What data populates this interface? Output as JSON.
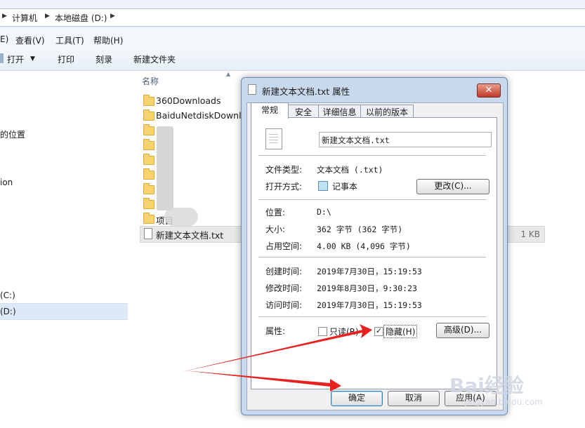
{
  "address": {
    "crumbs": [
      "计算机",
      "本地磁盘 (D:)"
    ]
  },
  "menu": {
    "view": "查看(V)",
    "tools": "工具(T)",
    "help": "帮助(H)"
  },
  "toolbar": {
    "open": "打开",
    "print": "打印",
    "burn": "刻录",
    "new_folder": "新建文件夹"
  },
  "nav": {
    "recent": "的位置",
    "cut_item": "ion",
    "drive_c": "(C:)",
    "drive_d": "(D:)"
  },
  "filelist": {
    "header_name": "名称",
    "files": [
      {
        "name": "360Downloads"
      },
      {
        "name": "BaiduNetdiskDownlo"
      },
      {
        "name": "新建文本文档.txt"
      }
    ],
    "item_tail": "项目",
    "selected_size": "1 KB"
  },
  "dialog": {
    "title": "新建文本文档.txt 属性",
    "close": "✕",
    "tabs": [
      "常规",
      "安全",
      "详细信息",
      "以前的版本"
    ],
    "file_name": "新建文本文档.txt",
    "type_label": "文件类型:",
    "type_value": "文本文档 (.txt)",
    "opens_label": "打开方式:",
    "opens_value": "记事本",
    "change_btn": "更改(C)...",
    "location_label": "位置:",
    "location_value": "D:\\",
    "size_label": "大小:",
    "size_value": "362 字节 (362 字节)",
    "disk_label": "占用空间:",
    "disk_value": "4.00 KB (4,096 字节)",
    "created_label": "创建时间:",
    "created_value": "2019年7月30日，15:19:53",
    "modified_label": "修改时间:",
    "modified_value": "2019年8月30日，9:30:23",
    "accessed_label": "访问时间:",
    "accessed_value": "2019年7月30日，15:19:53",
    "attr_label": "属性:",
    "readonly_label": "只读(R)",
    "hidden_label": "隐藏(H)",
    "advanced_btn": "高级(D)...",
    "ok_btn": "确定",
    "cancel_btn": "取消",
    "apply_btn": "应用(A)"
  },
  "watermark": {
    "brand": "Bai经验",
    "url": "jingyan.baidu.com"
  },
  "colors": {
    "arrow": "#e8201f",
    "accent": "#c0392b"
  }
}
